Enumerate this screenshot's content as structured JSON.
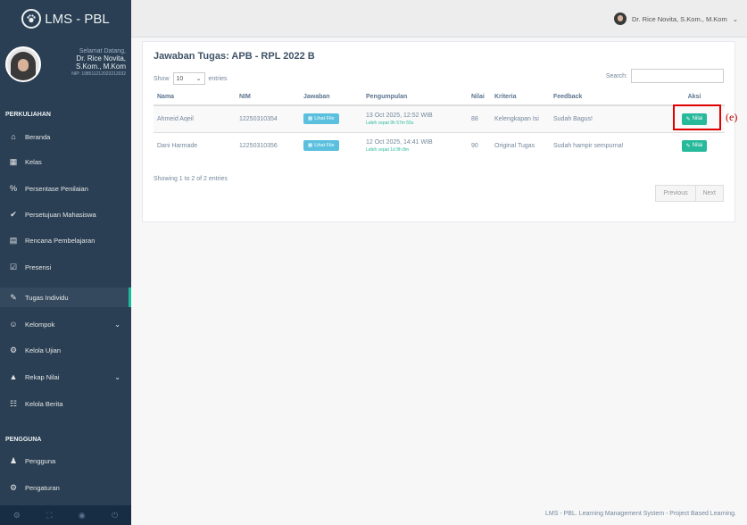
{
  "brand": {
    "title": "LMS - PBL"
  },
  "profile": {
    "welcome": "Selamat Datang,",
    "name_line1": "Dr. Rice Novita,",
    "name_line2": "S.Kom., M.Kom",
    "nip": "NIP: 198511212023212032"
  },
  "menu": {
    "section_kuliah": "PERKULIAHAN",
    "items": [
      {
        "label": "Beranda",
        "icon": "home-icon"
      },
      {
        "label": "Kelas",
        "icon": "building-icon"
      },
      {
        "label": "Persentase Penilaian",
        "icon": "percent-icon"
      },
      {
        "label": "Persetujuan Mahasiswa",
        "icon": "check-circle-icon"
      },
      {
        "label": "Rencana Pembelajaran",
        "icon": "file-text-icon"
      },
      {
        "label": "Presensi",
        "icon": "check-square-icon"
      },
      {
        "label": "Tugas Individu",
        "icon": "edit-icon"
      },
      {
        "label": "Kelompok",
        "icon": "users-icon"
      },
      {
        "label": "Kelola Ujian",
        "icon": "cogs-icon"
      },
      {
        "label": "Rekap Nilai",
        "icon": "graduation-cap-icon"
      },
      {
        "label": "Kelola Berita",
        "icon": "newspaper-icon"
      }
    ],
    "section_pengguna": "PENGGUNA",
    "items2": [
      {
        "label": "Pengguna",
        "icon": "user-icon"
      },
      {
        "label": "Pengaturan",
        "icon": "cog-icon"
      }
    ]
  },
  "topbar": {
    "user_name": "Dr. Rice Novita, S.Kom., M.Kom"
  },
  "panel": {
    "title": "Jawaban Tugas: APB - RPL 2022 B",
    "show_label": "Show",
    "show_value": "10",
    "entries_label": "entries",
    "search_label": "Search:",
    "columns": [
      "Nama",
      "NIM",
      "Jawaban",
      "Pengumpulan",
      "Nilai",
      "Kriteria",
      "Feedback",
      "Aksi"
    ],
    "rows": [
      {
        "nama": "Ahmeid Aqeil",
        "nim": "12250310354",
        "file_btn": "Lihat File",
        "pengumpulan": "13 Oct 2025, 12:52 WIB",
        "pengumpulan_sub": "Lebih cepat 9h 57m 55s",
        "nilai": "88",
        "kriteria": "Kelengkapan Isi",
        "feedback": "Sudah Bagus!",
        "aksi_btn": "Nilai"
      },
      {
        "nama": "Dani Harmade",
        "nim": "12250310356",
        "file_btn": "Lihat File",
        "pengumpulan": "12 Oct 2025, 14:41 WIB",
        "pengumpulan_sub": "Lebih cepat 1d 8h 8m",
        "nilai": "90",
        "kriteria": "Original Tugas",
        "feedback": "Sudah hampir sempurna!",
        "aksi_btn": "Nilai"
      }
    ],
    "info": "Showing 1 to 2 of 2 entries",
    "prev": "Previous",
    "next": "Next"
  },
  "annotation": {
    "label": "(e)"
  },
  "footer": {
    "text": "LMS - PBL. Learning Management System - Project Based Learning."
  }
}
